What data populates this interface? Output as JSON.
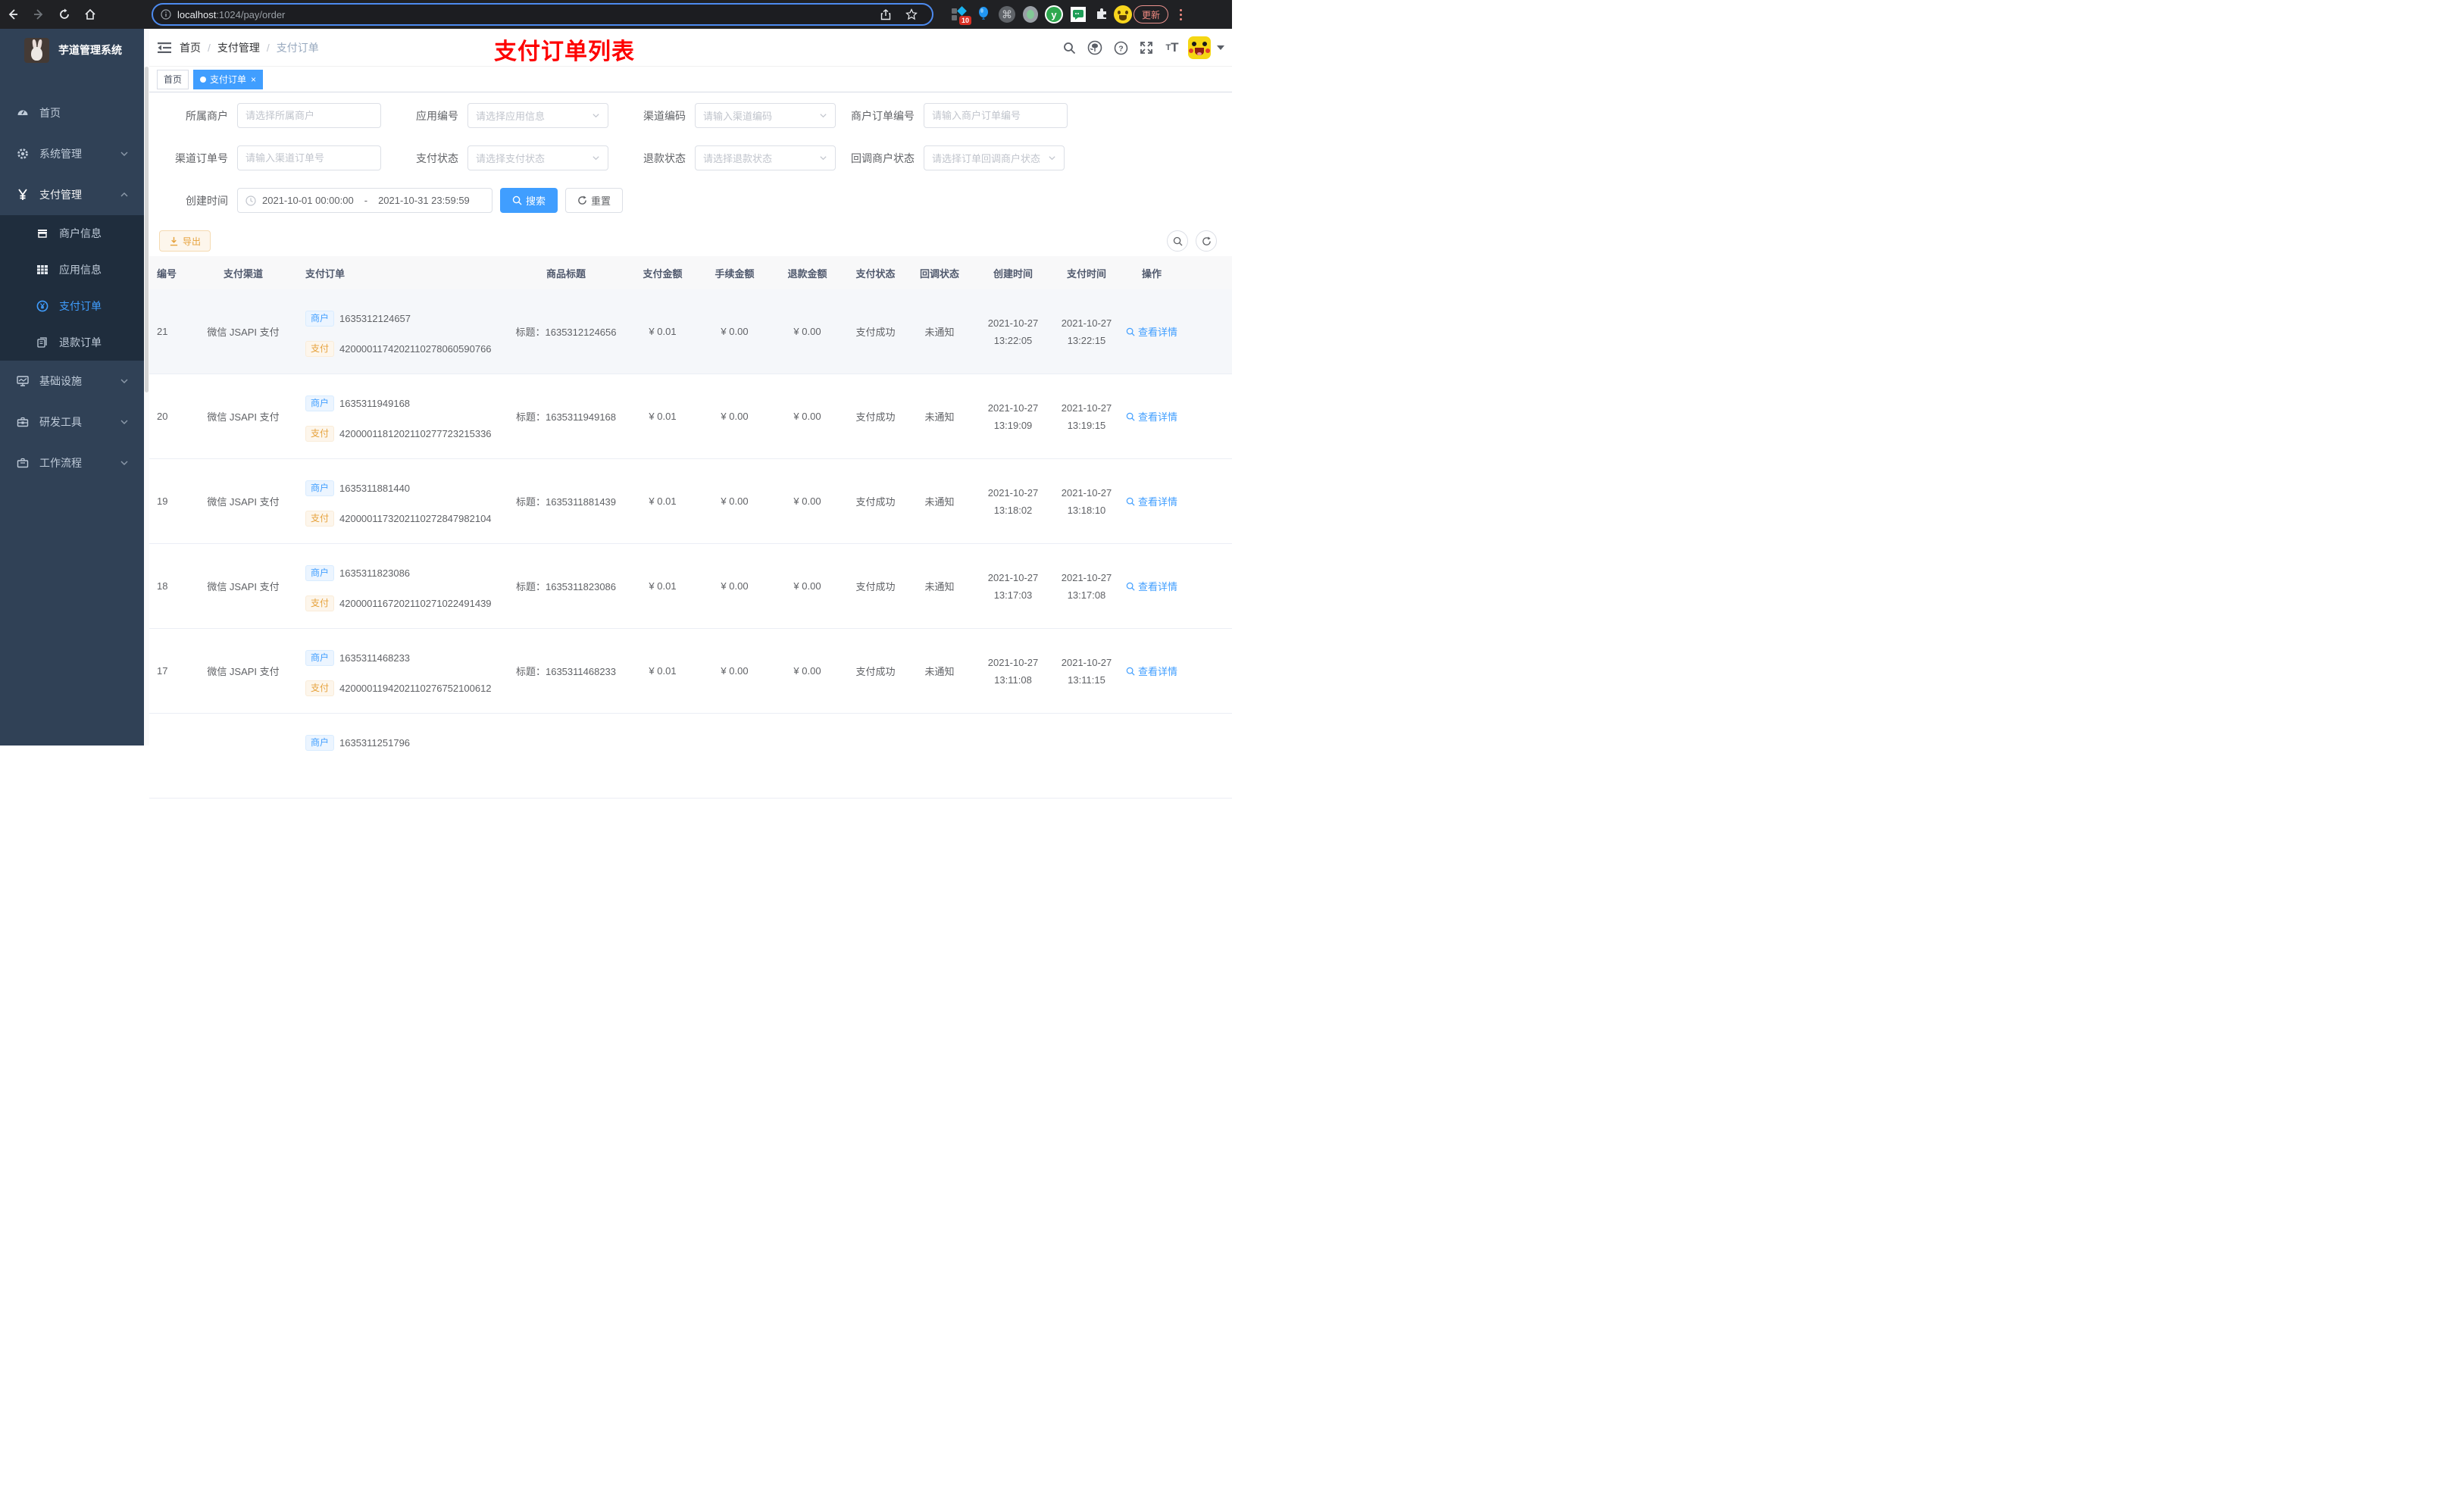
{
  "browser": {
    "url_host": "localhost",
    "url_rest": ":1024/pay/order",
    "extension_badge": "10",
    "update_label": "更新"
  },
  "app": {
    "title": "芋道管理系统"
  },
  "sidebar": {
    "home": "首页",
    "system": "系统管理",
    "pay": "支付管理",
    "sub": [
      "商户信息",
      "应用信息",
      "支付订单",
      "退款订单"
    ],
    "infra": "基础设施",
    "dev": "研发工具",
    "flow": "工作流程"
  },
  "header": {
    "crumb0": "首页",
    "crumb1": "支付管理",
    "crumb2": "支付订单",
    "separator": "/",
    "annotation": "支付订单列表"
  },
  "tags_view": {
    "tab0": "首页",
    "tab1": "支付订单",
    "close": "×"
  },
  "filters": {
    "fields": [
      {
        "label": "所属商户",
        "placeholder": "请选择所属商户"
      },
      {
        "label": "应用编号",
        "placeholder": "请选择应用信息"
      },
      {
        "label": "渠道编码",
        "placeholder": "请输入渠道编码"
      },
      {
        "label": "商户订单编号",
        "placeholder": "请输入商户订单编号"
      },
      {
        "label": "渠道订单号",
        "placeholder": "请输入渠道订单号"
      },
      {
        "label": "支付状态",
        "placeholder": "请选择支付状态"
      },
      {
        "label": "退款状态",
        "placeholder": "请选择退款状态"
      },
      {
        "label": "回调商户状态",
        "placeholder": "请选择订单回调商户状态"
      }
    ],
    "date": {
      "label": "创建时间",
      "start": "2021-10-01 00:00:00",
      "separator": "-",
      "end": "2021-10-31 23:59:59"
    },
    "search_label": "搜索",
    "reset_label": "重置"
  },
  "toolbar": {
    "export_label": "导出"
  },
  "table": {
    "columns": [
      "编号",
      "支付渠道",
      "支付订单",
      "商品标题",
      "支付金额",
      "手续金额",
      "退款金额",
      "支付状态",
      "回调状态",
      "创建时间",
      "支付时间",
      "操作"
    ],
    "tag_merchant": "商户",
    "tag_pay": "支付",
    "detail_label": "查看详情",
    "rows": [
      {
        "id": "21",
        "channel": "微信 JSAPI 支付",
        "mno": "1635312124657",
        "pno": "4200001174202110278060590766",
        "title": "标题：1635312124656",
        "amount": "¥ 0.01",
        "fee": "¥ 0.00",
        "refund": "¥ 0.00",
        "status": "支付成功",
        "notify": "未通知",
        "cdate": "2021-10-27",
        "ctime": "13:22:05",
        "pdate": "2021-10-27",
        "ptime": "13:22:15"
      },
      {
        "id": "20",
        "channel": "微信 JSAPI 支付",
        "mno": "1635311949168",
        "pno": "4200001181202110277723215336",
        "title": "标题：1635311949168",
        "amount": "¥ 0.01",
        "fee": "¥ 0.00",
        "refund": "¥ 0.00",
        "status": "支付成功",
        "notify": "未通知",
        "cdate": "2021-10-27",
        "ctime": "13:19:09",
        "pdate": "2021-10-27",
        "ptime": "13:19:15"
      },
      {
        "id": "19",
        "channel": "微信 JSAPI 支付",
        "mno": "1635311881440",
        "pno": "4200001173202110272847982104",
        "title": "标题：1635311881439",
        "amount": "¥ 0.01",
        "fee": "¥ 0.00",
        "refund": "¥ 0.00",
        "status": "支付成功",
        "notify": "未通知",
        "cdate": "2021-10-27",
        "ctime": "13:18:02",
        "pdate": "2021-10-27",
        "ptime": "13:18:10"
      },
      {
        "id": "18",
        "channel": "微信 JSAPI 支付",
        "mno": "1635311823086",
        "pno": "4200001167202110271022491439",
        "title": "标题：1635311823086",
        "amount": "¥ 0.01",
        "fee": "¥ 0.00",
        "refund": "¥ 0.00",
        "status": "支付成功",
        "notify": "未通知",
        "cdate": "2021-10-27",
        "ctime": "13:17:03",
        "pdate": "2021-10-27",
        "ptime": "13:17:08"
      },
      {
        "id": "17",
        "channel": "微信 JSAPI 支付",
        "mno": "1635311468233",
        "pno": "4200001194202110276752100612",
        "title": "标题：1635311468233",
        "amount": "¥ 0.01",
        "fee": "¥ 0.00",
        "refund": "¥ 0.00",
        "status": "支付成功",
        "notify": "未通知",
        "cdate": "2021-10-27",
        "ctime": "13:11:08",
        "pdate": "2021-10-27",
        "ptime": "13:11:15"
      },
      {
        "id": "",
        "channel": "",
        "mno": "1635311251796",
        "pno": "",
        "title": "",
        "amount": "",
        "fee": "",
        "refund": "",
        "status": "",
        "notify": "",
        "cdate": "",
        "ctime": "",
        "pdate": "",
        "ptime": ""
      }
    ]
  },
  "colors": {
    "accent": "#409eff",
    "warning": "#e6a23c",
    "annotation_red": "#fe0000",
    "sidebar_bg": "#304156",
    "submenu_bg": "#1f2d3d"
  }
}
